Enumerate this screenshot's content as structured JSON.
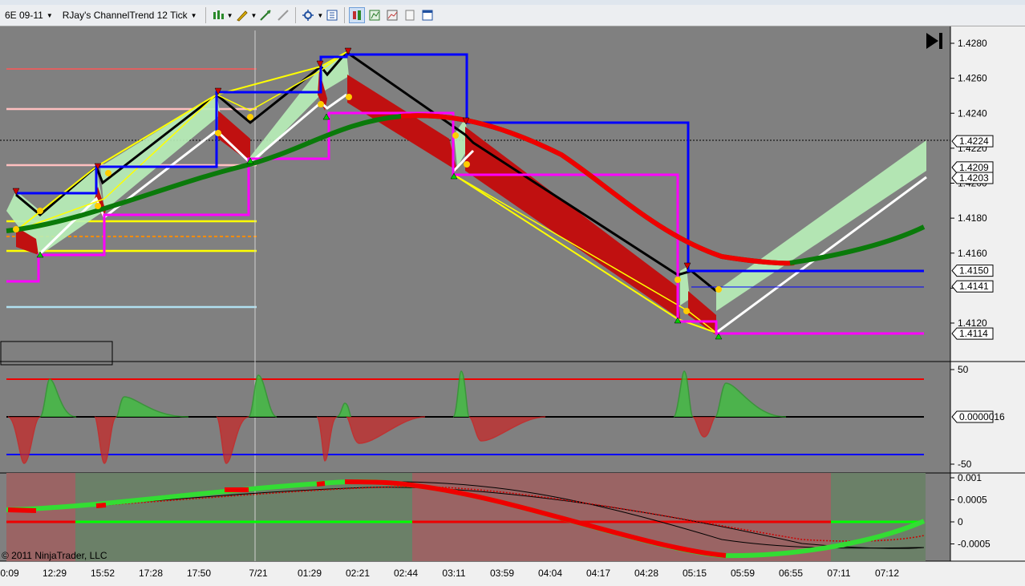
{
  "toolbar": {
    "instrument": "6E 09-11",
    "chart_type": "RJay's ChannelTrend  12 Tick",
    "icons": [
      "bar-type-icon",
      "drawing-tools-icon",
      "crosshair-icon",
      "snap-icon",
      "zoom-icon",
      "properties-icon",
      "data-box-icon",
      "indicators-icon",
      "strategies-icon",
      "window-icon"
    ]
  },
  "chart": {
    "copyright": "© 2011 NinjaTrader, LLC",
    "price_axis": [
      "1.4280",
      "1.4260",
      "1.4240",
      "1.4220",
      "1.4200",
      "1.4180",
      "1.4160",
      "1.4140",
      "1.4120"
    ],
    "price_boxes": [
      "1.4224",
      "1.4209",
      "1.4203",
      "1.4150",
      "1.4141",
      "1.4114"
    ],
    "osc_axis": [
      "50",
      "-50"
    ],
    "osc_box": "0.0000016",
    "macd_axis": [
      "0.001",
      "0.0005",
      "0",
      "-0.0005"
    ],
    "time_axis": [
      "0:09",
      "12:29",
      "15:52",
      "17:28",
      "17:50",
      "7/21",
      "01:29",
      "02:21",
      "02:44",
      "03:11",
      "03:59",
      "04:04",
      "04:17",
      "04:28",
      "05:15",
      "05:59",
      "06:55",
      "07:11",
      "07:12"
    ]
  },
  "chart_data": {
    "type": "line",
    "series": []
  }
}
